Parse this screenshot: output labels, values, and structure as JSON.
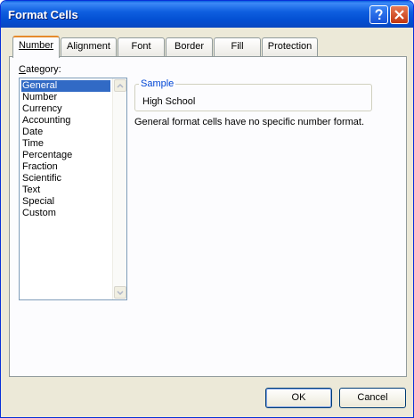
{
  "window": {
    "title": "Format Cells"
  },
  "tabs": [
    {
      "label": "Number",
      "active": true
    },
    {
      "label": "Alignment",
      "active": false
    },
    {
      "label": "Font",
      "active": false
    },
    {
      "label": "Border",
      "active": false
    },
    {
      "label": "Fill",
      "active": false
    },
    {
      "label": "Protection",
      "active": false
    }
  ],
  "category": {
    "label_accel": "C",
    "label_rest": "ategory:",
    "selected": "General",
    "items": [
      "General",
      "Number",
      "Currency",
      "Accounting",
      "Date",
      "Time",
      "Percentage",
      "Fraction",
      "Scientific",
      "Text",
      "Special",
      "Custom"
    ]
  },
  "sample": {
    "legend": "Sample",
    "value": "High School"
  },
  "description": "General format cells have no specific number format.",
  "buttons": {
    "ok": "OK",
    "cancel": "Cancel"
  },
  "icons": {
    "help": "help-icon",
    "close": "close-icon",
    "scroll_up": "chevron-up-icon",
    "scroll_down": "chevron-down-icon"
  },
  "colors": {
    "titlebar": "#0a5fdf",
    "selection": "#316ac5",
    "active_tab_accent": "#e68b2c",
    "sample_legend": "#0046d5"
  }
}
